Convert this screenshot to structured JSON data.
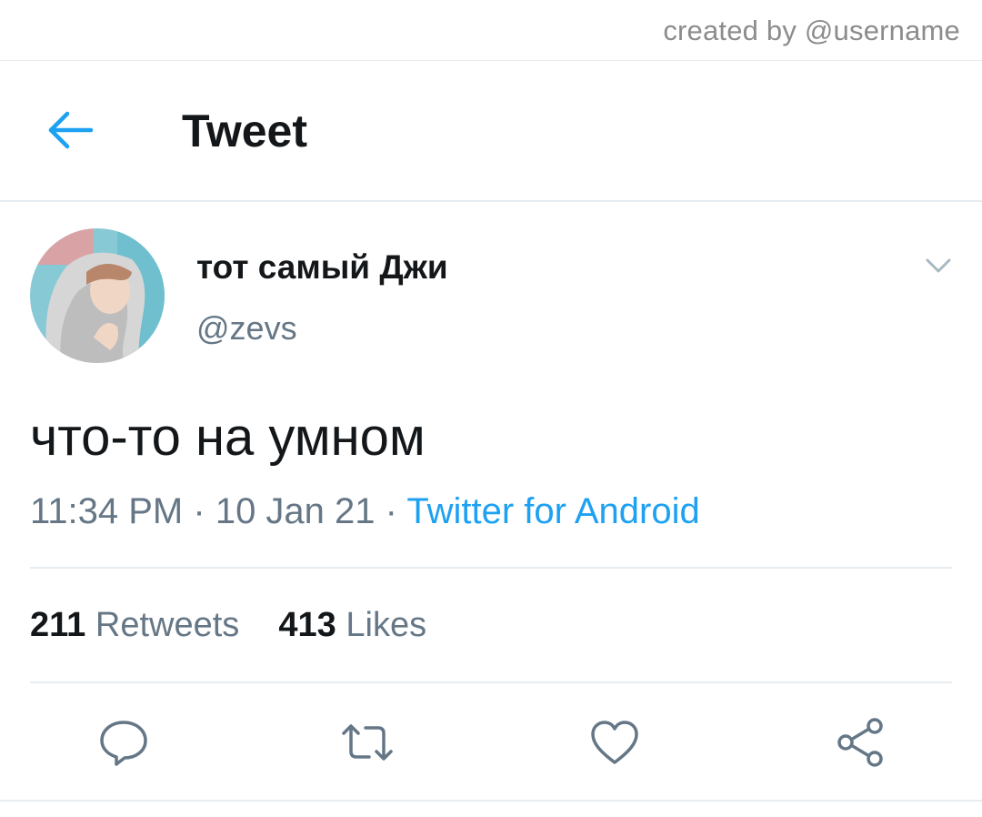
{
  "watermark": "created by @username",
  "header": {
    "title": "Tweet",
    "back_icon": "arrow-left-icon"
  },
  "tweet": {
    "display_name": "тот самый Джи",
    "handle": "@zevs",
    "text": "что-то на умном",
    "time": "11:34 PM",
    "date": "10 Jan 21",
    "source": "Twitter for Android",
    "separator": "·",
    "retweets_count": "211",
    "retweets_label": "Retweets",
    "likes_count": "413",
    "likes_label": "Likes"
  },
  "actions": [
    "reply-icon",
    "retweet-icon",
    "like-icon",
    "share-icon"
  ],
  "colors": {
    "accent": "#1da1f2",
    "text": "#14171a",
    "secondary": "#657786",
    "divider": "#e6ecf0"
  }
}
